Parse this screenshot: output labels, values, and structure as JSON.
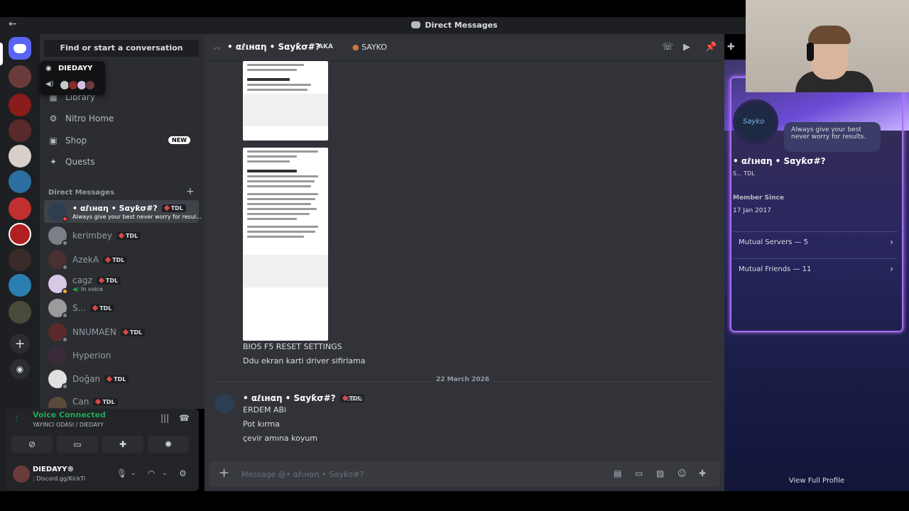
{
  "window": {
    "title": "Direct Messages",
    "back_icon": "arrow-left-icon"
  },
  "sidebar": {
    "search_label": "Find or start a conversation",
    "nav": [
      {
        "label": "Library",
        "icon": "library-icon"
      },
      {
        "label": "Nitro Home",
        "icon": "nitro-icon"
      },
      {
        "label": "Shop",
        "icon": "shop-icon",
        "badge": "NEW"
      },
      {
        "label": "Quests",
        "icon": "quests-icon"
      }
    ],
    "dm_header": "Direct Messages",
    "dms": [
      {
        "name": "• αℓιнαη • Ѕαуƙσ#?",
        "tag": "TDL",
        "status": "Always give your best never worry for resul...",
        "selected": true,
        "color": "#2d3d52"
      },
      {
        "name": "kerimbey",
        "tag": "TDL",
        "color": "#7a7f88"
      },
      {
        "name": "AzekA",
        "tag": "TDL",
        "color": "#4a3030"
      },
      {
        "name": "cagz",
        "tag": "TDL",
        "status": "In voice",
        "color": "#d8c8e8"
      },
      {
        "name": "S...",
        "tag": "TDL",
        "color": "#9b9b9b"
      },
      {
        "name": "NNUMAEN",
        "tag": "TDL",
        "color": "#5a2a2a"
      },
      {
        "name": "Hyperion",
        "tag": "",
        "color": "#3a2a3a"
      },
      {
        "name": "Doğan",
        "tag": "TDL",
        "color": "#e0e0e0"
      },
      {
        "name": "Can",
        "tag": "TDL",
        "color": "#5a4a3a"
      }
    ]
  },
  "voice": {
    "title": "Voice Connected",
    "channel": "YAYINCI ODASI / DIEDAYY"
  },
  "user": {
    "name": "DIEDAYY®",
    "status": ": Discord.gg/KickTi"
  },
  "popup": {
    "title": "DIEDAYY"
  },
  "chat": {
    "header_name": "• αℓιнαη • Ѕαуƙσ#?",
    "aka": "AKA",
    "aka_name": "SAYKO",
    "messages_before": [
      "BIOS F5 RESET SETTINGS",
      "Ddu ekran karti driver sifirlama"
    ],
    "date_divider": "22 March 2026",
    "author": "• αℓιнαη • Ѕαуƙσ#?",
    "author_tag": "TDL",
    "time": "03:35",
    "messages": [
      "ERDEM ABi",
      "Pot kırma",
      "çevir amına koyum"
    ],
    "composer_placeholder": "Message @• αℓιнαη • Ѕαуƙσ#?"
  },
  "profile": {
    "bubble": "Always give your best never worry for results.",
    "name": "• αℓιнαη • Ѕαуƙσ#?",
    "tags": "S...  TDL",
    "member_since_label": "Member Since",
    "member_since": "17 Jan 2017",
    "mutual_servers": "Mutual Servers — 5",
    "mutual_friends": "Mutual Friends — 11",
    "view_full": "View Full Profile"
  },
  "colors": {
    "accent": "#5865f2",
    "voice": "#23a55a",
    "profile_border": "#a86bff"
  }
}
